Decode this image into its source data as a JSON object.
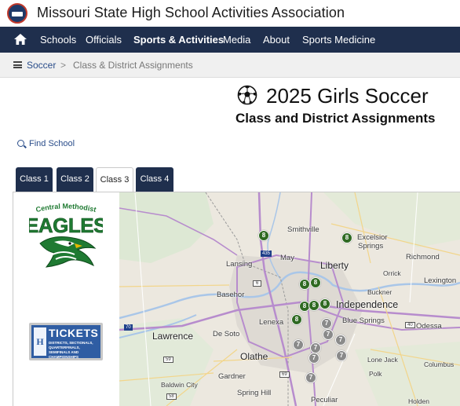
{
  "site": {
    "title": "Missouri State High School Activities Association"
  },
  "nav": {
    "items": [
      {
        "label": "Schools"
      },
      {
        "label": "Officials"
      },
      {
        "label": "Sports & Activities"
      },
      {
        "label": "Media"
      },
      {
        "label": "About"
      },
      {
        "label": "Sports Medicine"
      }
    ]
  },
  "breadcrumb": {
    "link": "Soccer",
    "separator": ">",
    "current": "Class & District Assignments"
  },
  "page": {
    "title": "2025 Girls Soccer",
    "subtitle": "Class and District Assignments",
    "find_school": "Find School"
  },
  "tabs": [
    {
      "label": "Class 1",
      "active": false
    },
    {
      "label": "Class 2",
      "active": false
    },
    {
      "label": "Class 3",
      "active": true
    },
    {
      "label": "Class 4",
      "active": false
    }
  ],
  "ads": {
    "eagles": {
      "top_text": "Central Methodist",
      "name": "EAGLES"
    },
    "tickets": {
      "h": "H",
      "title": "TICKETS",
      "subtitle": "DISTRICTS, SECTIONALS, QUARTERFINALS, SEMIFINALS AND CHAMPIONSHIPS"
    }
  },
  "map": {
    "labels": {
      "smithville": "Smithville",
      "excelsior": "Excelsior",
      "springs": "Springs",
      "richmond": "Richmond",
      "may": "May",
      "lansing": "Lansing",
      "liberty": "Liberty",
      "orrick": "Orrick",
      "lexington": "Lexington",
      "basehor": "Basehor",
      "buckner": "Buckner",
      "independence": "Independence",
      "blue_springs": "Blue Springs",
      "odessa": "Odessa",
      "lawrence": "Lawrence",
      "de_soto": "De Soto",
      "lenexa": "Lenexa",
      "olathe": "Olathe",
      "lone_jack": "Lone Jack",
      "columbus": "Columbus",
      "polk": "Polk",
      "gardner": "Gardner",
      "baldwin_city": "Baldwin City",
      "spring_hill": "Spring Hill",
      "peculiar": "Peculiar",
      "holden": "Holden"
    },
    "shields": {
      "i435": "435",
      "r92": "6",
      "i70": "70",
      "i470": "470",
      "r40": "40",
      "r59": "59",
      "r69": "69",
      "r58": "58"
    },
    "markers": {
      "class8": "8",
      "class7": "7"
    },
    "colors": {
      "class8": "#2f6a22",
      "class7": "#8a8a8a"
    }
  }
}
